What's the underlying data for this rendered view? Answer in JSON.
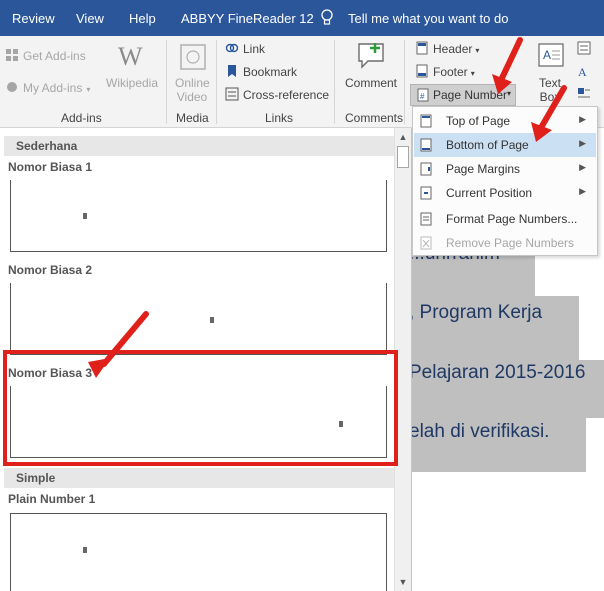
{
  "menubar": {
    "tabs": [
      "Review",
      "View",
      "Help",
      "ABBYY FineReader 12"
    ],
    "tell_me": "Tell me what you want to do"
  },
  "ribbon": {
    "addins": {
      "get_addins": "Get Add-ins",
      "my_addins": "My Add-ins",
      "wikipedia": "Wikipedia",
      "group_label": "Add-ins"
    },
    "media": {
      "online_video_line1": "Online",
      "online_video_line2": "Video",
      "group_label": "Media"
    },
    "links": {
      "link": "Link",
      "bookmark": "Bookmark",
      "cross_reference": "Cross-reference",
      "group_label": "Links"
    },
    "comments": {
      "comment": "Comment",
      "group_label": "Comments"
    },
    "header_footer": {
      "header": "Header",
      "footer": "Footer",
      "page_number": "Page Number"
    },
    "text": {
      "text_box_line1": "Text",
      "text_box_line2": "Box"
    }
  },
  "page_number_menu": {
    "items": [
      {
        "label": "Top of Page",
        "submenu": true
      },
      {
        "label": "Bottom of Page",
        "submenu": true
      },
      {
        "label": "Page Margins",
        "submenu": true
      },
      {
        "label": "Current Position",
        "submenu": true
      },
      {
        "label": "Format Page Numbers...",
        "submenu": false
      },
      {
        "label": "Remove Page Numbers",
        "submenu": false
      }
    ]
  },
  "gallery": {
    "sections": [
      {
        "header": "Sederhana"
      },
      {
        "header": "Simple"
      }
    ],
    "items": [
      {
        "title": "Nomor Biasa 1"
      },
      {
        "title": "Nomor Biasa 2"
      },
      {
        "title": "Nomor Biasa 3"
      },
      {
        "title": "Plain Number 1"
      }
    ]
  },
  "document": {
    "lines": [
      "...uhrrahim",
      ", Program Kerja",
      "Pelajaran 2015-2016",
      "elah di verifikasi."
    ]
  },
  "colors": {
    "menubar_bg": "#2b579a",
    "highlight_red": "#e0201b",
    "menu_active": "#cce0f4"
  }
}
